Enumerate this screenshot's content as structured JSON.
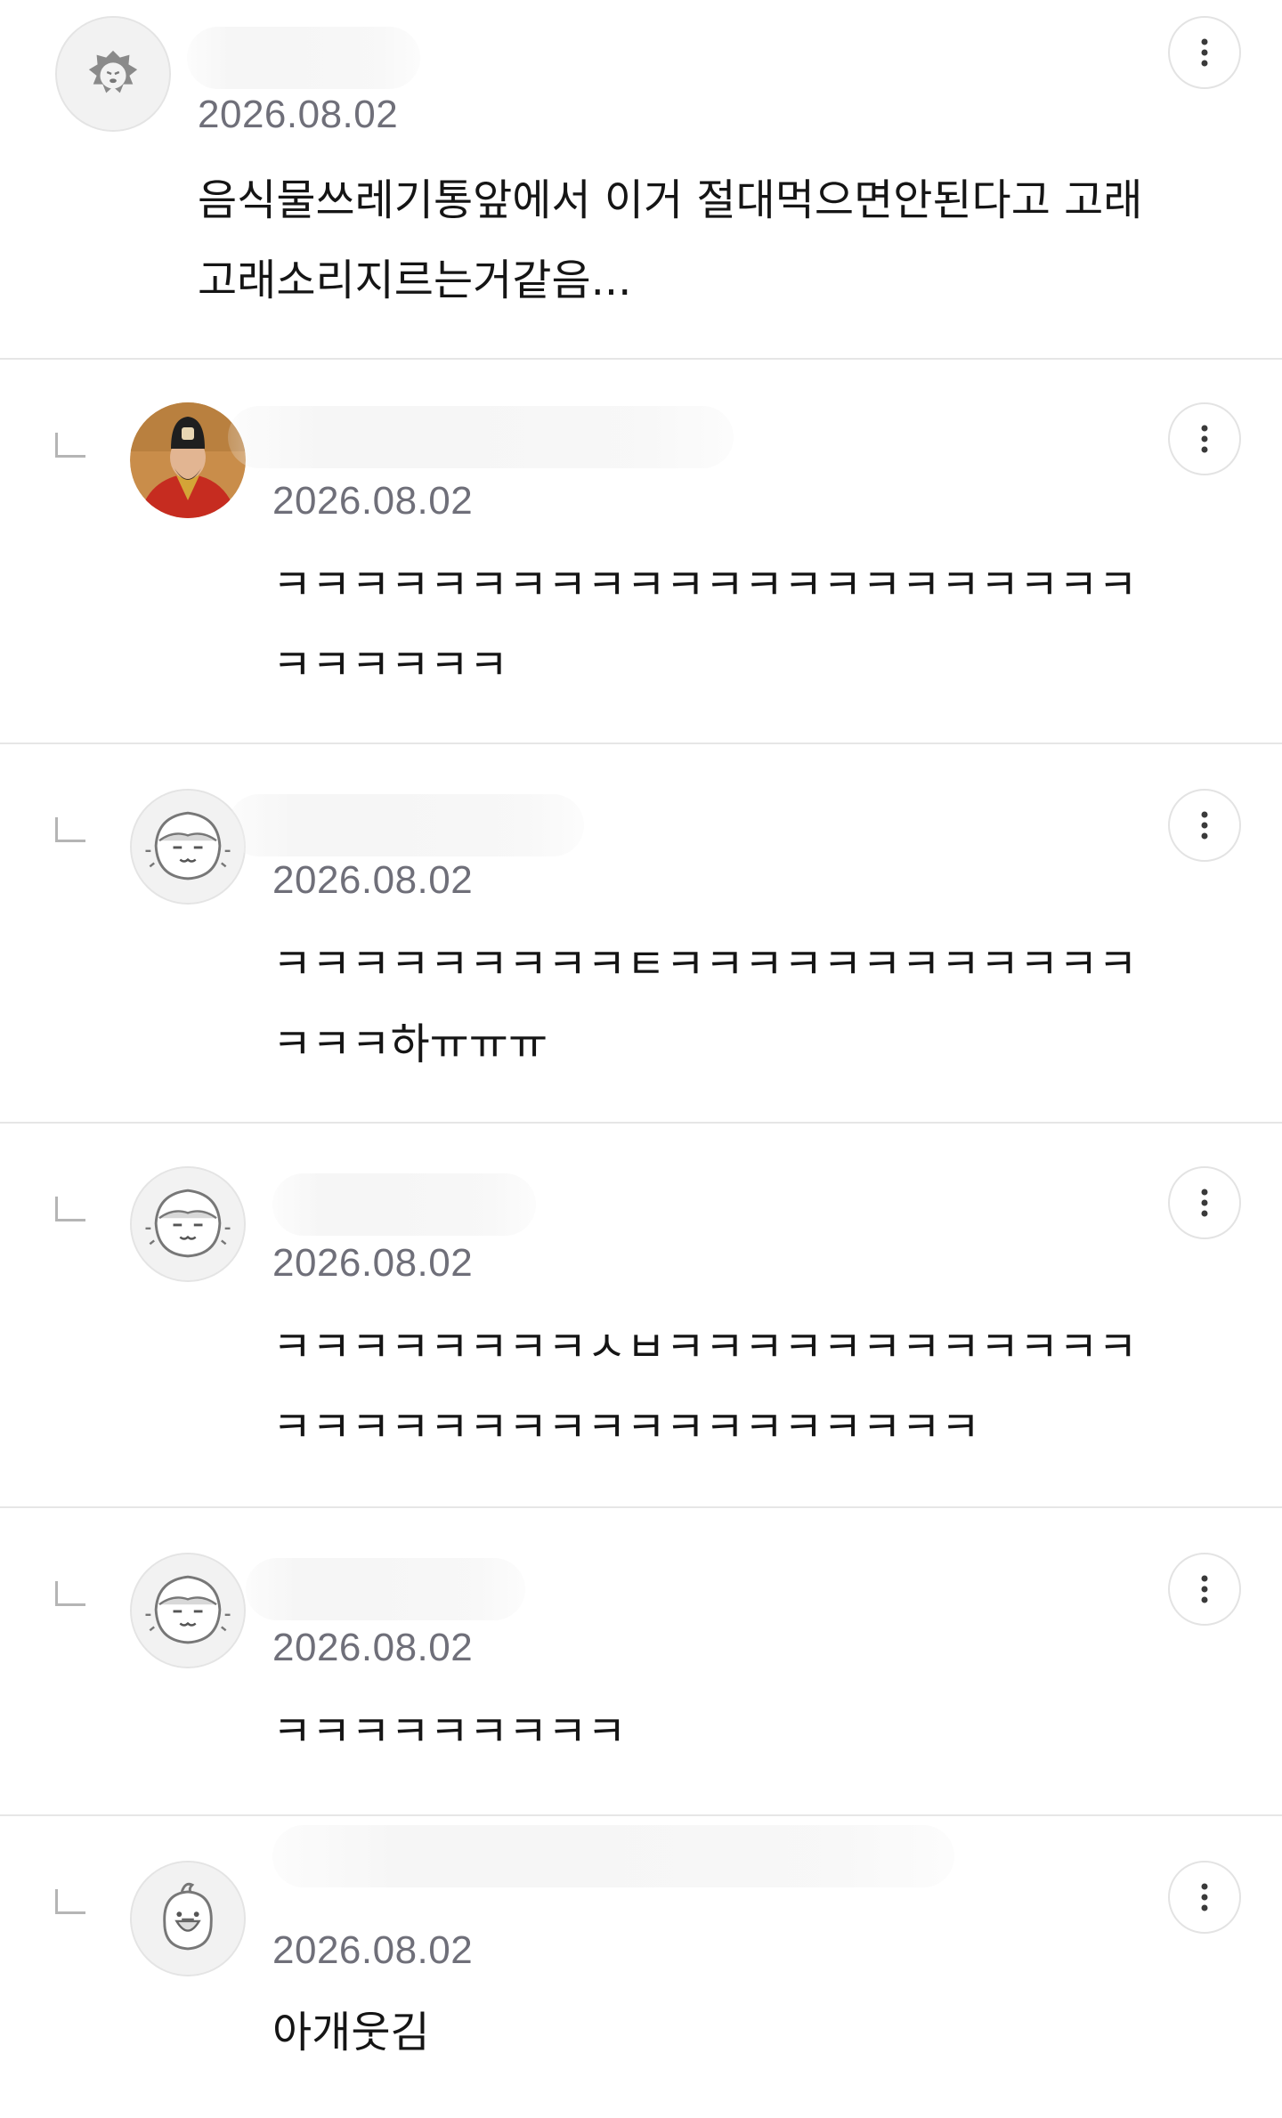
{
  "comments": [
    {
      "is_reply": false,
      "avatar": "lion-avatar-icon",
      "date": "2026.08.02",
      "text": "음식물쓰레기통앞에서 이거 절대먹으면안된다고 고래고래소리지르는거같음..."
    },
    {
      "is_reply": true,
      "avatar": "king-portrait-avatar",
      "date": "2026.08.02",
      "text": "ㅋㅋㅋㅋㅋㅋㅋㅋㅋㅋㅋㅋㅋㅋㅋㅋㅋㅋㅋㅋㅋㅋㅋㅋㅋㅋㅋㅋ"
    },
    {
      "is_reply": true,
      "avatar": "shell-character-avatar",
      "date": "2026.08.02",
      "text": "ㅋㅋㅋㅋㅋㅋㅋㅋㅋㅌㅋㅋㅋㅋㅋㅋㅋㅋㅋㅋㅋㅋㅋㅋㅋ하ㅠㅠㅠ"
    },
    {
      "is_reply": true,
      "avatar": "shell-character-avatar",
      "date": "2026.08.02",
      "text": "ㅋㅋㅋㅋㅋㅋㅋㅋㅅㅂㅋㅋㅋㅋㅋㅋㅋㅋㅋㅋㅋㅋㅋㅋㅋㅋㅋㅋㅋㅋㅋㅋㅋㅋㅋㅋㅋㅋㅋㅋ"
    },
    {
      "is_reply": true,
      "avatar": "shell-character-avatar",
      "date": "2026.08.02",
      "text": "ㅋㅋㅋㅋㅋㅋㅋㅋㅋ"
    },
    {
      "is_reply": true,
      "avatar": "bird-character-avatar",
      "date": "2026.08.02",
      "text": "아개웃김"
    }
  ],
  "colors": {
    "date": "#6f6f79",
    "divider": "#e6e6e6",
    "text": "#151515"
  }
}
